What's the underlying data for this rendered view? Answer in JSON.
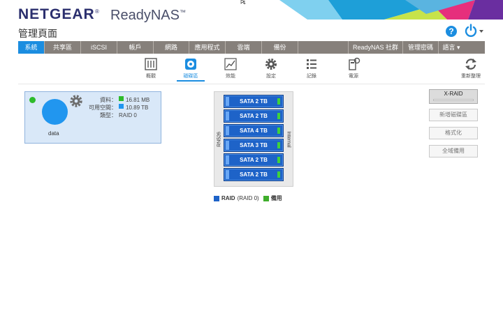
{
  "header": {
    "brand": "NETGEAR",
    "brand_mark": "®",
    "product": "ReadyNAS",
    "product_mark": "™",
    "page_title": "管理頁面",
    "help_icon": "question-icon",
    "help_glyph": "?",
    "power_icon": "power-icon"
  },
  "colors": {
    "accent": "#1b8de0",
    "nav_bg": "#86807b",
    "volume_blue": "#2196ef",
    "ok_green": "#2dbb2b",
    "disk_blue": "#1e63c8"
  },
  "nav": {
    "items": [
      {
        "label": "系統",
        "active": true
      },
      {
        "label": "共享區"
      },
      {
        "label": "iSCSI"
      },
      {
        "label": "帳戶"
      },
      {
        "label": "網路"
      },
      {
        "label": "應用程式"
      },
      {
        "label": "雲端"
      },
      {
        "label": "備份"
      },
      {
        "label": ""
      },
      {
        "label": "ReadyNAS 社群"
      },
      {
        "label": "管理密碼"
      },
      {
        "label": "語言 ▾"
      }
    ]
  },
  "subtabs": {
    "items": [
      {
        "label": "概觀",
        "icon": "overview-icon"
      },
      {
        "label": "磁碟區",
        "icon": "volume-icon",
        "active": true
      },
      {
        "label": "效能",
        "icon": "performance-icon"
      },
      {
        "label": "設定",
        "icon": "settings-gear-icon"
      },
      {
        "label": "記錄",
        "icon": "logs-icon"
      },
      {
        "label": "電源",
        "icon": "power-settings-icon"
      },
      {
        "label": "重新整理",
        "icon": "refresh-icon"
      }
    ]
  },
  "volume": {
    "name": "data",
    "status": "healthy",
    "data_label": "資料：",
    "data_value": "16.81 MB",
    "free_label": "可用空間：",
    "free_value": "10.89 TB",
    "type_label": "類型：",
    "type_value": "RAID 0"
  },
  "enclosure": {
    "model": "RN526",
    "location": "Internal",
    "disks": [
      {
        "label": "SATA 2 TB"
      },
      {
        "label": "SATA 2 TB"
      },
      {
        "label": "SATA 4 TB"
      },
      {
        "label": "SATA 3 TB"
      },
      {
        "label": "SATA 2 TB"
      },
      {
        "label": "SATA 2 TB"
      }
    ]
  },
  "legend": {
    "raid_label": "RAID",
    "raid_detail": "(RAID 0)",
    "spare_label": "備用"
  },
  "actions": {
    "xraid": "X-RAID",
    "new_volume": "新增磁碟區",
    "format": "格式化",
    "global_spare": "全域備用"
  }
}
